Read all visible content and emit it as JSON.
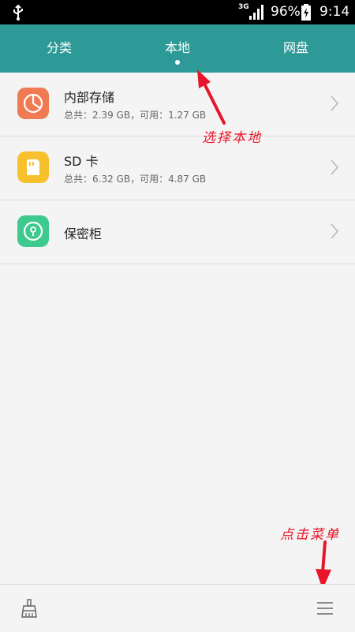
{
  "status_bar": {
    "network_type": "3G",
    "battery_percent": "96%",
    "time": "9:14",
    "icons": [
      "usb-icon",
      "signal-icon",
      "battery-charging-icon"
    ]
  },
  "tabs": [
    {
      "label": "分类",
      "active": false
    },
    {
      "label": "本地",
      "active": true
    },
    {
      "label": "网盘",
      "active": false
    }
  ],
  "storage_items": [
    {
      "title": "内部存储",
      "subtitle": "总共：2.39 GB，可用：1.27 GB",
      "icon": "pie-chart-icon",
      "color": "#f07a52"
    },
    {
      "title": "SD 卡",
      "subtitle": "总共：6.32 GB，可用：4.87 GB",
      "icon": "sd-card-icon",
      "color": "#f7c12e"
    },
    {
      "title": "保密柜",
      "subtitle": "",
      "icon": "lock-icon",
      "color": "#3ec98e"
    }
  ],
  "annotations": {
    "select_local": "选择本地",
    "tap_menu": "点击菜单",
    "color": "#e8162a"
  },
  "bottom_bar": {
    "icons": [
      "broom-icon",
      "menu-icon"
    ]
  }
}
